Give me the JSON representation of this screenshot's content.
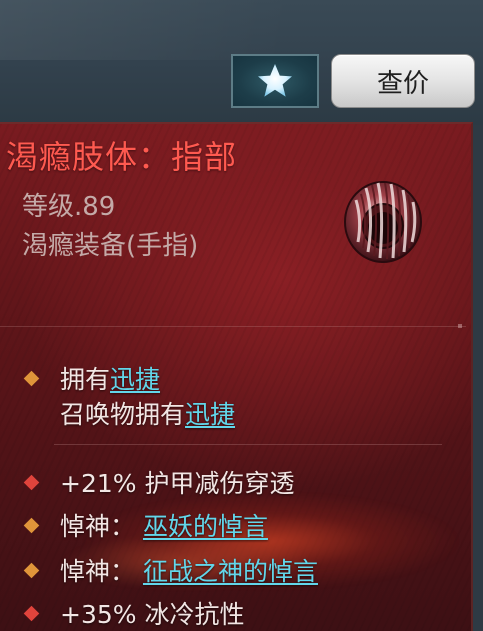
{
  "header": {
    "favorite_icon": "star-icon",
    "price_button_label": "查价"
  },
  "item": {
    "name": "渴瘾肢体：指部",
    "level": "等级.89",
    "type": "渴瘾装备(手指)",
    "icon": "ring-icon"
  },
  "affixes_group1": [
    {
      "prefix": "拥有",
      "link": "迅捷"
    },
    {
      "prefix": "召唤物拥有",
      "link": "迅捷"
    }
  ],
  "affixes_group2": [
    {
      "text": "+21% 护甲减伤穿透"
    },
    {
      "prefix": "悼神：",
      "link": "巫妖的悼言"
    },
    {
      "prefix": "悼神：",
      "link": "征战之神的悼言"
    },
    {
      "text": "+35% 冰冷抗性"
    }
  ],
  "colors": {
    "title": "#ff5a50",
    "link": "#62d6ea",
    "bullet_gold": "#e0953a",
    "bullet_red": "#e0443c"
  }
}
